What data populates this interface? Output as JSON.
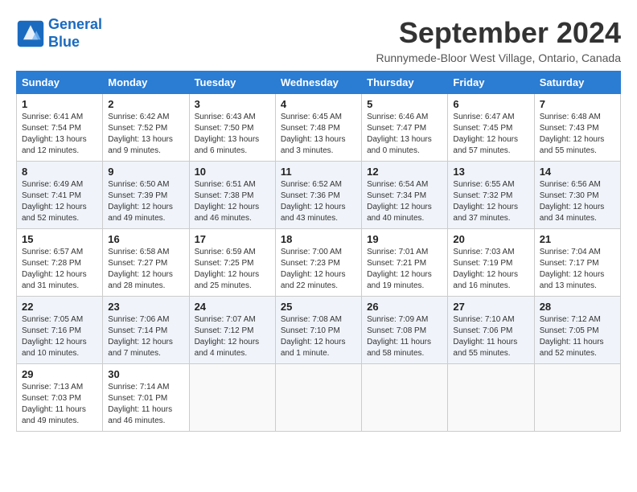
{
  "header": {
    "logo_line1": "General",
    "logo_line2": "Blue",
    "month_title": "September 2024",
    "location": "Runnymede-Bloor West Village, Ontario, Canada"
  },
  "weekdays": [
    "Sunday",
    "Monday",
    "Tuesday",
    "Wednesday",
    "Thursday",
    "Friday",
    "Saturday"
  ],
  "weeks": [
    [
      {
        "day": "1",
        "info": "Sunrise: 6:41 AM\nSunset: 7:54 PM\nDaylight: 13 hours and 12 minutes."
      },
      {
        "day": "2",
        "info": "Sunrise: 6:42 AM\nSunset: 7:52 PM\nDaylight: 13 hours and 9 minutes."
      },
      {
        "day": "3",
        "info": "Sunrise: 6:43 AM\nSunset: 7:50 PM\nDaylight: 13 hours and 6 minutes."
      },
      {
        "day": "4",
        "info": "Sunrise: 6:45 AM\nSunset: 7:48 PM\nDaylight: 13 hours and 3 minutes."
      },
      {
        "day": "5",
        "info": "Sunrise: 6:46 AM\nSunset: 7:47 PM\nDaylight: 13 hours and 0 minutes."
      },
      {
        "day": "6",
        "info": "Sunrise: 6:47 AM\nSunset: 7:45 PM\nDaylight: 12 hours and 57 minutes."
      },
      {
        "day": "7",
        "info": "Sunrise: 6:48 AM\nSunset: 7:43 PM\nDaylight: 12 hours and 55 minutes."
      }
    ],
    [
      {
        "day": "8",
        "info": "Sunrise: 6:49 AM\nSunset: 7:41 PM\nDaylight: 12 hours and 52 minutes."
      },
      {
        "day": "9",
        "info": "Sunrise: 6:50 AM\nSunset: 7:39 PM\nDaylight: 12 hours and 49 minutes."
      },
      {
        "day": "10",
        "info": "Sunrise: 6:51 AM\nSunset: 7:38 PM\nDaylight: 12 hours and 46 minutes."
      },
      {
        "day": "11",
        "info": "Sunrise: 6:52 AM\nSunset: 7:36 PM\nDaylight: 12 hours and 43 minutes."
      },
      {
        "day": "12",
        "info": "Sunrise: 6:54 AM\nSunset: 7:34 PM\nDaylight: 12 hours and 40 minutes."
      },
      {
        "day": "13",
        "info": "Sunrise: 6:55 AM\nSunset: 7:32 PM\nDaylight: 12 hours and 37 minutes."
      },
      {
        "day": "14",
        "info": "Sunrise: 6:56 AM\nSunset: 7:30 PM\nDaylight: 12 hours and 34 minutes."
      }
    ],
    [
      {
        "day": "15",
        "info": "Sunrise: 6:57 AM\nSunset: 7:28 PM\nDaylight: 12 hours and 31 minutes."
      },
      {
        "day": "16",
        "info": "Sunrise: 6:58 AM\nSunset: 7:27 PM\nDaylight: 12 hours and 28 minutes."
      },
      {
        "day": "17",
        "info": "Sunrise: 6:59 AM\nSunset: 7:25 PM\nDaylight: 12 hours and 25 minutes."
      },
      {
        "day": "18",
        "info": "Sunrise: 7:00 AM\nSunset: 7:23 PM\nDaylight: 12 hours and 22 minutes."
      },
      {
        "day": "19",
        "info": "Sunrise: 7:01 AM\nSunset: 7:21 PM\nDaylight: 12 hours and 19 minutes."
      },
      {
        "day": "20",
        "info": "Sunrise: 7:03 AM\nSunset: 7:19 PM\nDaylight: 12 hours and 16 minutes."
      },
      {
        "day": "21",
        "info": "Sunrise: 7:04 AM\nSunset: 7:17 PM\nDaylight: 12 hours and 13 minutes."
      }
    ],
    [
      {
        "day": "22",
        "info": "Sunrise: 7:05 AM\nSunset: 7:16 PM\nDaylight: 12 hours and 10 minutes."
      },
      {
        "day": "23",
        "info": "Sunrise: 7:06 AM\nSunset: 7:14 PM\nDaylight: 12 hours and 7 minutes."
      },
      {
        "day": "24",
        "info": "Sunrise: 7:07 AM\nSunset: 7:12 PM\nDaylight: 12 hours and 4 minutes."
      },
      {
        "day": "25",
        "info": "Sunrise: 7:08 AM\nSunset: 7:10 PM\nDaylight: 12 hours and 1 minute."
      },
      {
        "day": "26",
        "info": "Sunrise: 7:09 AM\nSunset: 7:08 PM\nDaylight: 11 hours and 58 minutes."
      },
      {
        "day": "27",
        "info": "Sunrise: 7:10 AM\nSunset: 7:06 PM\nDaylight: 11 hours and 55 minutes."
      },
      {
        "day": "28",
        "info": "Sunrise: 7:12 AM\nSunset: 7:05 PM\nDaylight: 11 hours and 52 minutes."
      }
    ],
    [
      {
        "day": "29",
        "info": "Sunrise: 7:13 AM\nSunset: 7:03 PM\nDaylight: 11 hours and 49 minutes."
      },
      {
        "day": "30",
        "info": "Sunrise: 7:14 AM\nSunset: 7:01 PM\nDaylight: 11 hours and 46 minutes."
      },
      {
        "day": "",
        "info": ""
      },
      {
        "day": "",
        "info": ""
      },
      {
        "day": "",
        "info": ""
      },
      {
        "day": "",
        "info": ""
      },
      {
        "day": "",
        "info": ""
      }
    ]
  ]
}
